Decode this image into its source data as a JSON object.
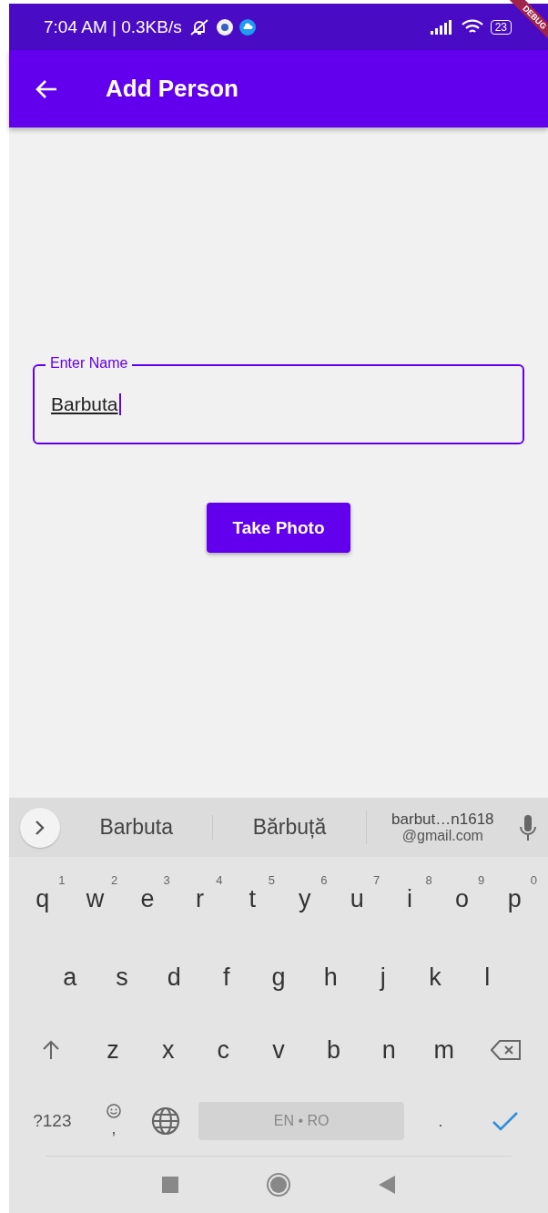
{
  "status_bar": {
    "info": "7:04 AM | 0.3KB/s",
    "battery": "23"
  },
  "debug_banner": "DEBUG",
  "app_bar": {
    "title": "Add Person"
  },
  "name_field": {
    "label": "Enter Name",
    "value": "Barbuta",
    "focused": true
  },
  "take_photo_button": "Take Photo",
  "keyboard": {
    "suggestions": [
      {
        "text": "Barbuta"
      },
      {
        "text": "Bărbuță"
      },
      {
        "text": "barbut…n1618",
        "subtext": "@gmail.com"
      }
    ],
    "rows": [
      {
        "keys": [
          {
            "kind": "letter",
            "text": "q",
            "hint": "1"
          },
          {
            "kind": "letter",
            "text": "w",
            "hint": "2"
          },
          {
            "kind": "letter",
            "text": "e",
            "hint": "3"
          },
          {
            "kind": "letter",
            "text": "r",
            "hint": "4"
          },
          {
            "kind": "letter",
            "text": "t",
            "hint": "5"
          },
          {
            "kind": "letter",
            "text": "y",
            "hint": "6"
          },
          {
            "kind": "letter",
            "text": "u",
            "hint": "7"
          },
          {
            "kind": "letter",
            "text": "i",
            "hint": "8"
          },
          {
            "kind": "letter",
            "text": "o",
            "hint": "9"
          },
          {
            "kind": "letter",
            "text": "p",
            "hint": "0"
          }
        ]
      },
      {
        "keys": [
          {
            "kind": "letter",
            "text": "a"
          },
          {
            "kind": "letter",
            "text": "s"
          },
          {
            "kind": "letter",
            "text": "d"
          },
          {
            "kind": "letter",
            "text": "f"
          },
          {
            "kind": "letter",
            "text": "g"
          },
          {
            "kind": "letter",
            "text": "h"
          },
          {
            "kind": "letter",
            "text": "j"
          },
          {
            "kind": "letter",
            "text": "k"
          },
          {
            "kind": "letter",
            "text": "l"
          }
        ]
      },
      {
        "keys": [
          {
            "kind": "shift"
          },
          {
            "kind": "letter",
            "text": "z"
          },
          {
            "kind": "letter",
            "text": "x"
          },
          {
            "kind": "letter",
            "text": "c"
          },
          {
            "kind": "letter",
            "text": "v"
          },
          {
            "kind": "letter",
            "text": "b"
          },
          {
            "kind": "letter",
            "text": "n"
          },
          {
            "kind": "letter",
            "text": "m"
          },
          {
            "kind": "backspace"
          }
        ]
      },
      {
        "keys": [
          {
            "kind": "symbols",
            "text": "?123"
          },
          {
            "kind": "emoji",
            "text": ","
          },
          {
            "kind": "globe"
          },
          {
            "kind": "space",
            "text": "EN • RO"
          },
          {
            "kind": "period",
            "text": "."
          },
          {
            "kind": "enter"
          }
        ]
      }
    ]
  }
}
